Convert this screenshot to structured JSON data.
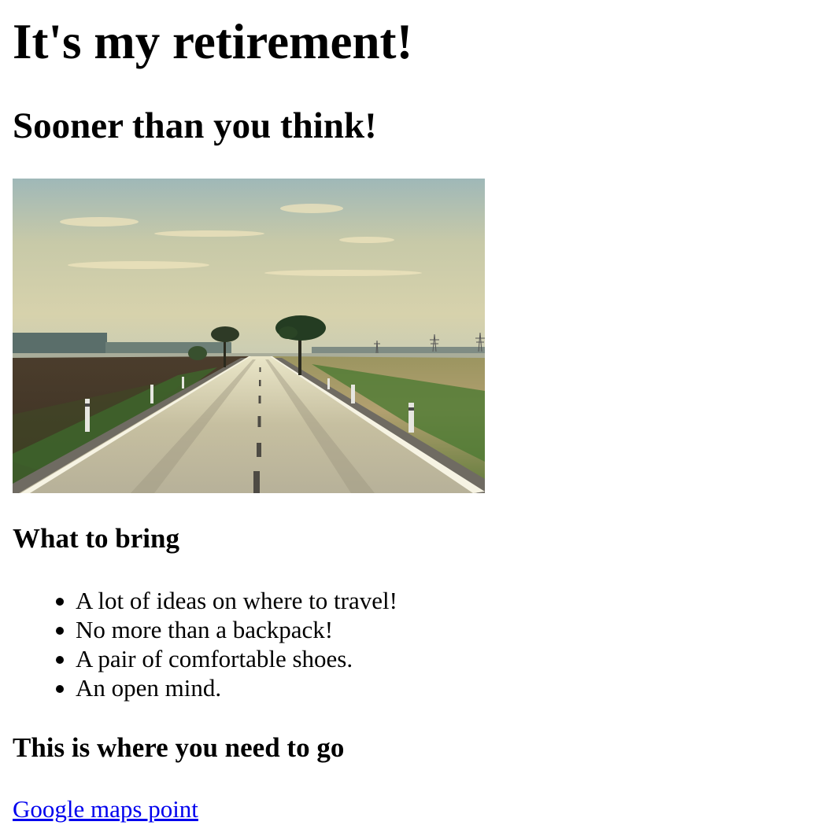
{
  "page": {
    "title": "It's my retirement!",
    "subtitle": "Sooner than you think!"
  },
  "photo": {
    "alt": "Empty country road stretching to the horizon"
  },
  "bring": {
    "heading": "What to bring",
    "items": [
      "A lot of ideas on where to travel!",
      "No more than a backpack!",
      "A pair of comfortable shoes.",
      "An open mind."
    ]
  },
  "destination": {
    "heading": "This is where you need to go",
    "link_label": "Google maps point"
  },
  "colors": {
    "link": "#0000ee",
    "text": "#000000",
    "background": "#ffffff"
  }
}
